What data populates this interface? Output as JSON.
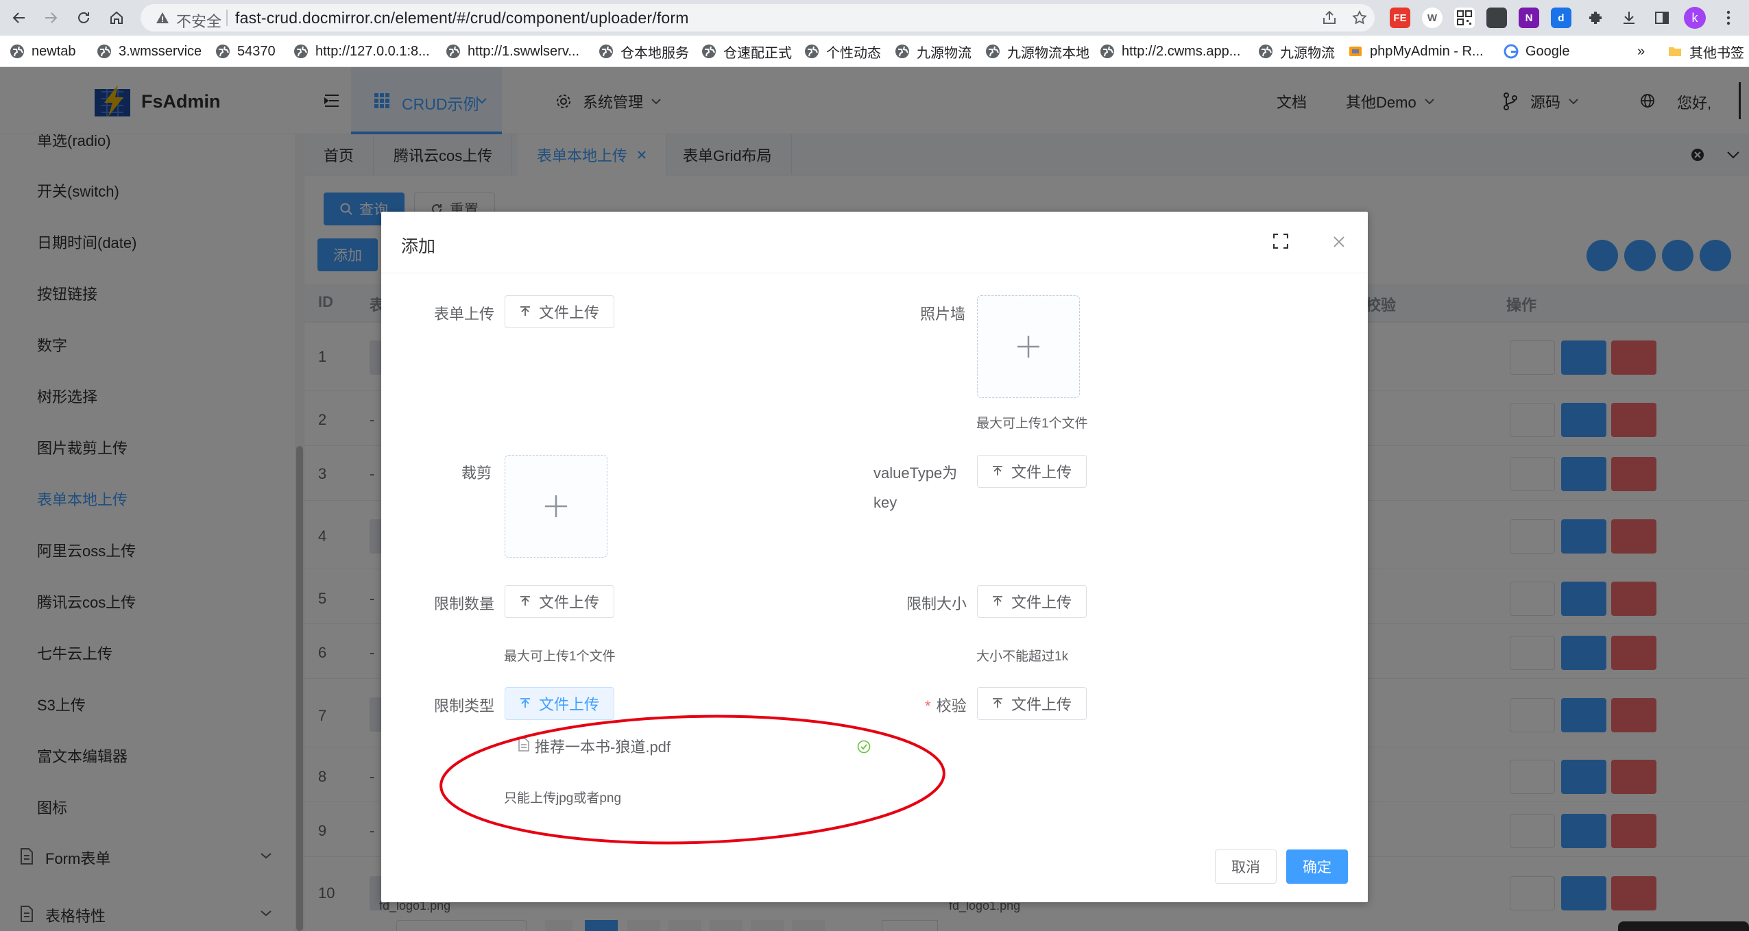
{
  "browser": {
    "insecure_label": "不安全",
    "url": "fast-crud.docmirror.cn/element/#/crud/component/uploader/form",
    "avatar_letter": "k",
    "ext_labels": [
      "FE",
      "W",
      "",
      "",
      "N",
      "d"
    ]
  },
  "bookmarks": {
    "items": [
      "newtab",
      "3.wmsservice",
      "54370",
      "http://127.0.0.1:8...",
      "http://1.swwlserv...",
      "仓本地服务",
      "仓速配正式",
      "个性动态",
      "九源物流",
      "九源物流本地",
      "http://2.cwms.app...",
      "九源物流",
      "phpMyAdmin - R...",
      "Google"
    ],
    "overflow": "»",
    "other": "其他书签"
  },
  "header": {
    "logo": "FsAdmin",
    "menu_crud": "CRUD示例",
    "menu_system": "系统管理",
    "docs": "文档",
    "other_demo": "其他Demo",
    "source": "源码",
    "greeting": "您好,"
  },
  "sidebar": {
    "items": [
      "单选(radio)",
      "开关(switch)",
      "日期时间(date)",
      "按钮链接",
      "数字",
      "树形选择",
      "图片裁剪上传",
      "表单本地上传",
      "阿里云oss上传",
      "腾讯云cos上传",
      "七牛云上传",
      "S3上传",
      "富文本编辑器",
      "图标"
    ],
    "active_index": 7,
    "group_form": "Form表单",
    "group_table": "表格特性"
  },
  "tabs": {
    "items": [
      "首页",
      "腾讯云cos上传",
      "表单本地上传",
      "表单Grid布局"
    ],
    "active_index": 2
  },
  "toolbar": {
    "search": "查询",
    "reset": "重置",
    "add": "添加"
  },
  "table": {
    "col_id": "ID",
    "col_table": "表",
    "col_check": "校验",
    "col_action": "操作",
    "row_ids": [
      "1",
      "2",
      "3",
      "4",
      "5",
      "6",
      "7",
      "8",
      "9",
      "10"
    ],
    "dash": "-",
    "partial_cell_left": "fd_logo1.png",
    "partial_cell_right": "fd_logo1.png"
  },
  "dialog": {
    "title": "添加",
    "upload_button_label": "文件上传",
    "fields": {
      "form_upload": "表单上传",
      "photo_wall": "照片墙",
      "photo_wall_tip": "最大可上传1个文件",
      "crop": "裁剪",
      "value_type_key_line1": "valueType为",
      "value_type_key_line2": "key",
      "limit_count": "限制数量",
      "limit_count_tip": "最大可上传1个文件",
      "limit_size": "限制大小",
      "limit_size_tip": "大小不能超过1k",
      "limit_type": "限制类型",
      "limit_type_tip": "只能上传jpg或者png",
      "validate": "校验",
      "required_mark": "*"
    },
    "uploaded_file": "推荐一本书-狼道.pdf",
    "cancel": "取消",
    "confirm": "确定"
  },
  "colors": {
    "primary": "#409eff",
    "danger": "#f56c6c",
    "success": "#67c23a",
    "annotation": "#e60012"
  }
}
